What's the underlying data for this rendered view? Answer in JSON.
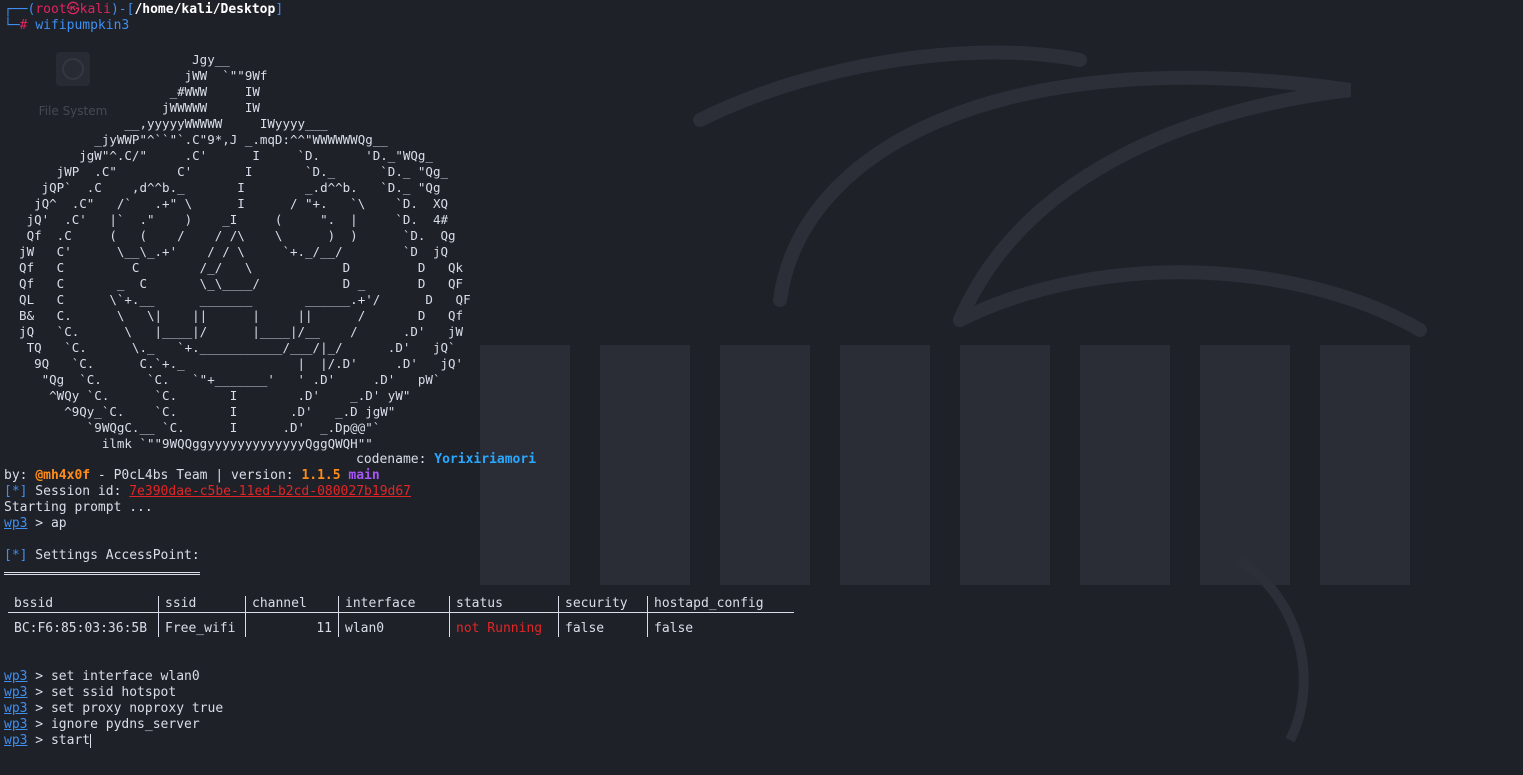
{
  "prompt_header": {
    "user": "root",
    "at_symbol": "㉿",
    "host": "kali",
    "cwd": "/home/kali/Desktop",
    "hash": "#",
    "command": "wifipumpkin3"
  },
  "desktop_icons": {
    "file_system_label": "File System"
  },
  "ascii_art": "                         Jgy__\n                        jWW  `\"\"9Wf\n                      _#WWW     IW\n                     jWWWWW     IW\n                __,yyyyyWWWWW     IWyyyy___\n            _jyWWP\"^``\"`.C\"9*,J _.mqD:^^\"WWWWWWQg__\n          jgW\"^.C/\"     .C'      I     `D.      'D._\"WQg_\n       jWP  .C\"        C'       I       `D._      `D._ \"Qg_\n     jQP`  .C    ,d^^b._       I        _.d^^b.   `D._ \"Qg\n    jQ^  .C\"   /`   .+\" \\      I      / \"+.   `\\    `D.  XQ\n   jQ'  .C'   |`  .\"    )    _I     (     \".  |     `D.  4#\n   Qf  .C     (   (    /    / /\\    \\      )  )      `D.  Qg\n  jW   C'      \\__\\_.+'    / / \\     `+._/__/        `D  jQ\n  Qf   C         C        /_/   \\            D         D   Qk\n  Qf   C       _  C       \\_\\____/           D _       D   QF\n  QL   C      \\`+.__      _______       ______.+'/      D   QF\n  B&   C.      \\   \\|    ||      |     ||      /       D   Qf\n  jQ   `C.      \\   |____|/      |____|/__    /      .D'   jW\n   TQ   `C.      \\._   `+.___________/___/|_/      .D'   jQ`\n    9Q   `C.      C.`+._               |  |/.D'     .D'   jQ'\n     \"Qg  `C.      `C.   `\"+_______'   ' .D'     .D'   pW`\n      ^WQy `C.      `C.       I        .D'    _.D' yW\"\n        ^9Qy_`C.    `C.       I       .D'   _.D jgW\"\n           `9WQgC.__ `C.      I      .D'  _.Dp@@\"`\n             ilmk `\"\"9WQQggyyyyyyyyyyyyyQggQWQH\"\"",
  "banner": {
    "codename_label": "codename:",
    "codename_value": "Yorixiriamori",
    "by_label": "by:",
    "author": "@mh4x0f",
    "team_text": " - P0cL4bs Team | version: ",
    "version": "1.1.5",
    "branch": "main"
  },
  "session": {
    "marker": "[*]",
    "label": " Session id: ",
    "id": "7e390dae-c5be-11ed-b2cd-080027b19d67"
  },
  "starting_prompt": "Starting prompt ...",
  "prompt_name": "wp3",
  "prompt_arrow": " > ",
  "first_command": "ap",
  "settings": {
    "marker": "[*]",
    "title": " Settings AccessPoint:"
  },
  "ap_table": {
    "headers": [
      "bssid",
      "ssid",
      "channel",
      "interface",
      "status",
      "security",
      "hostapd_config"
    ],
    "row": {
      "bssid": "BC:F6:85:03:36:5B",
      "ssid": "Free_wifi",
      "channel": "11",
      "interface": "wlan0",
      "status": "not Running",
      "security": "false",
      "hostapd_config": "false"
    }
  },
  "commands": [
    "set interface wlan0",
    "set ssid hotspot",
    "set proxy noproxy true",
    "ignore pydns_server",
    "start"
  ]
}
